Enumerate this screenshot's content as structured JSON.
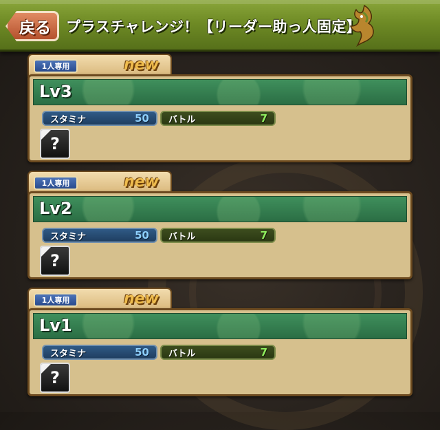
{
  "header": {
    "back_label": "戻る",
    "title": "プラスチャレンジ！【リーダー助っ人固定】"
  },
  "stages": [
    {
      "badge": "1人専用",
      "new_label": "new",
      "level": "Lv3",
      "stamina_label": "スタミナ",
      "stamina": "50",
      "battle_label": "バトル",
      "battles": "7",
      "reward": "?"
    },
    {
      "badge": "1人専用",
      "new_label": "new",
      "level": "Lv2",
      "stamina_label": "スタミナ",
      "stamina": "50",
      "battle_label": "バトル",
      "battles": "7",
      "reward": "?"
    },
    {
      "badge": "1人専用",
      "new_label": "new",
      "level": "Lv1",
      "stamina_label": "スタミナ",
      "stamina": "50",
      "battle_label": "バトル",
      "battles": "7",
      "reward": "?"
    }
  ]
}
